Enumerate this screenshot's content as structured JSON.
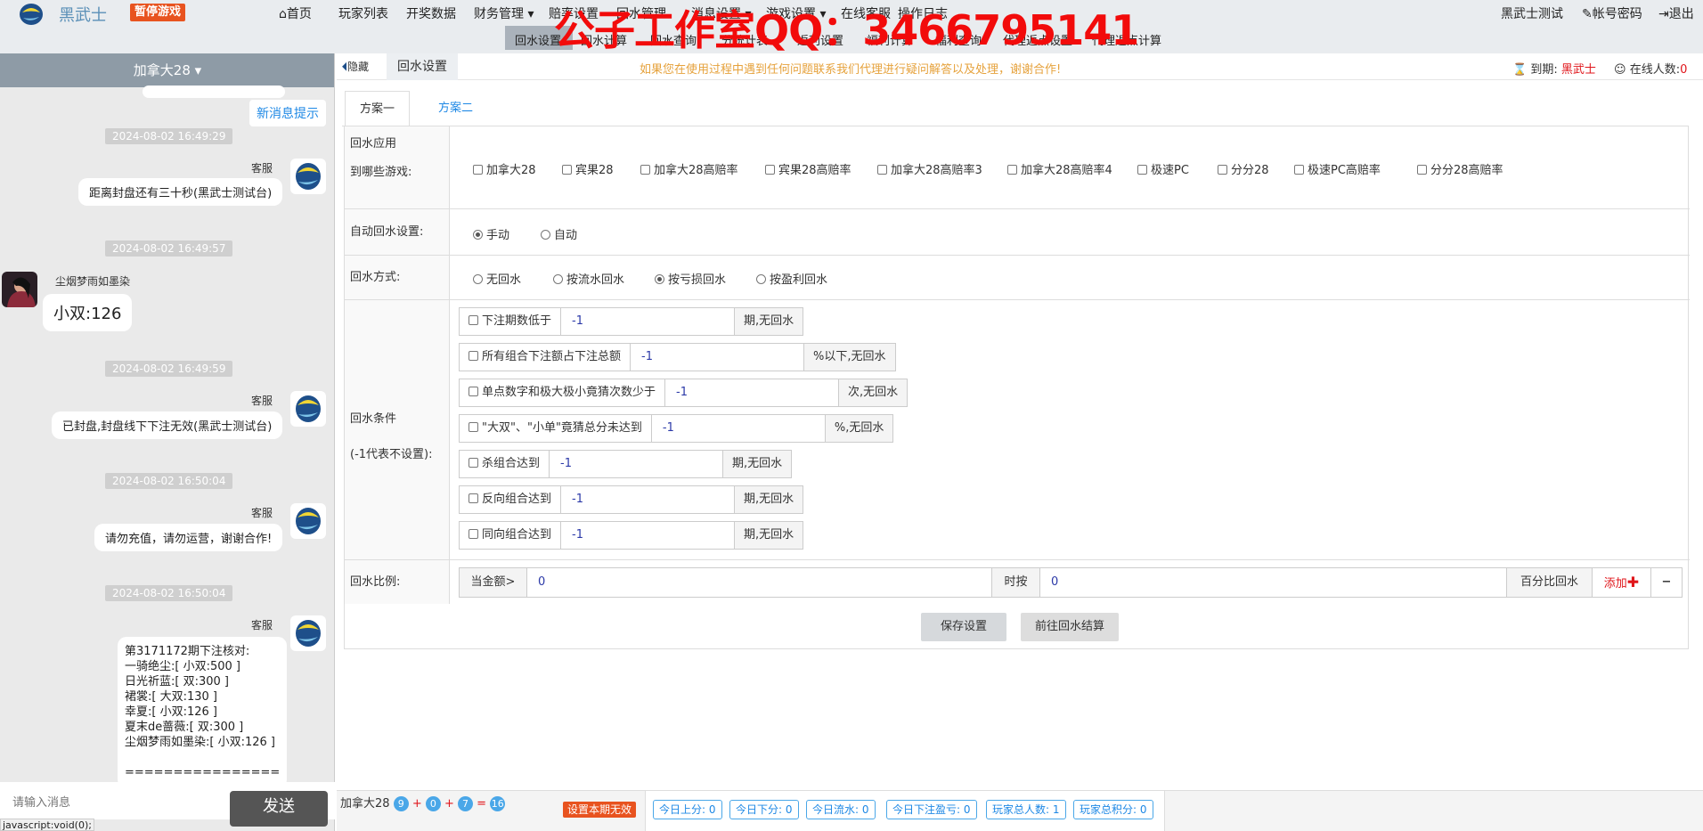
{
  "brand": {
    "name": "黑武士",
    "pause_label": "暂停游戏"
  },
  "watermark": "公子工作室QQ：3466795141",
  "nav_primary": [
    "首页",
    "玩家列表",
    "开奖数据",
    "财务管理",
    "赔率设置",
    "回水管理",
    "消息设置",
    "游戏设置",
    "在线客服",
    "操作日志"
  ],
  "nav_secondary": [
    "回水设置",
    "回水计算",
    "回水查询",
    "分统计表",
    "返利设置",
    "福利计算",
    "福利查询",
    "代理返点设置",
    "代理返点计算"
  ],
  "top_right": {
    "user": "黑武士测试",
    "password": "帐号密码",
    "logout": "退出"
  },
  "chat": {
    "room": "加拿大28",
    "new_msg": "新消息提示",
    "input_placeholder": "请输入消息",
    "send": "发送",
    "status_url": "javascript:void(0);",
    "messages": [
      {
        "time": "2024-08-02 16:49:29",
        "sender": "客服",
        "text": "距离封盘还有三十秒(黑武士测试台)"
      },
      {
        "time": "2024-08-02 16:49:57",
        "sender": "尘烟梦雨如墨染",
        "text": "小双:126"
      },
      {
        "time": "2024-08-02 16:49:59",
        "sender": "客服",
        "text": "已封盘,封盘线下下注无效(黑武士测试台)"
      },
      {
        "time": "2024-08-02 16:50:04",
        "sender": "客服",
        "text": "请勿充值，请勿运营，谢谢合作!"
      },
      {
        "time": "2024-08-02 16:50:04",
        "sender": "客服",
        "lines": [
          "第3171172期下注核对:",
          "一骑绝尘:[ 小双:500 ]",
          "日光祈蓝:[ 双:300 ]",
          "裙裳:[ 大双:130 ]",
          "幸夏:[ 小双:126 ]",
          "夏末de蔷薇:[ 双:300 ]",
          "尘烟梦雨如墨染:[ 小双:126 ]",
          "",
          "================"
        ]
      }
    ]
  },
  "header": {
    "hide": "隐藏",
    "title": "回水设置",
    "notice": "如果您在使用过程中遇到任何问题联系我们代理进行疑问解答以及处理，谢谢合作!",
    "expire_label": "到期:",
    "expire_value": "黑武士",
    "online_label": "在线人数:",
    "online_value": "0"
  },
  "tabs": [
    "方案一",
    "方案二"
  ],
  "form": {
    "apply_label_1": "回水应用",
    "apply_label_2": "到哪些游戏:",
    "games": [
      "加拿大28",
      "宾果28",
      "加拿大28高赔率",
      "宾果28高赔率",
      "加拿大28高赔率3",
      "加拿大28高赔率4",
      "极速PC",
      "分分28",
      "极速PC高赔率",
      "分分28高赔率"
    ],
    "auto_label": "自动回水设置:",
    "auto_options": [
      "手动",
      "自动"
    ],
    "auto_selected": "手动",
    "mode_label": "回水方式:",
    "mode_options": [
      "无回水",
      "按流水回水",
      "按亏损回水",
      "按盈利回水"
    ],
    "mode_selected": "按亏损回水",
    "cond_label_1": "回水条件",
    "cond_label_2": "(-1代表不设置):",
    "conditions": [
      {
        "label": "下注期数低于",
        "value": "-1",
        "suffix": "期,无回水"
      },
      {
        "label": "所有组合下注额占下注总额",
        "value": "-1",
        "suffix": "%以下,无回水"
      },
      {
        "label": "单点数字和极大极小竟猜次数少于",
        "value": "-1",
        "suffix": "次,无回水"
      },
      {
        "label": "\"大双\"、\"小单\"竟猜总分未达到",
        "value": "-1",
        "suffix": "%,无回水"
      },
      {
        "label": "杀组合达到",
        "value": "-1",
        "suffix": "期,无回水"
      },
      {
        "label": "反向组合达到",
        "value": "-1",
        "suffix": "期,无回水"
      },
      {
        "label": "同向组合达到",
        "value": "-1",
        "suffix": "期,无回水"
      }
    ],
    "ratio_label": "回水比例:",
    "ratio_when": "当金额>",
    "ratio_amount": "0",
    "ratio_by": "时按",
    "ratio_percent": "0",
    "ratio_unit": "百分比回水",
    "add": "添加",
    "remove": "−",
    "save": "保存设置",
    "goto": "前往回水结算"
  },
  "bottom": {
    "game": "加拿大28",
    "balls": [
      "9",
      "0",
      "7",
      "16"
    ],
    "invalid": "设置本期无效",
    "stats": [
      "今日上分: 0",
      "今日下分: 0",
      "今日流水: 0",
      "今日下注盈亏: 0",
      "玩家总人数: 1",
      "玩家总积分: 0"
    ]
  }
}
